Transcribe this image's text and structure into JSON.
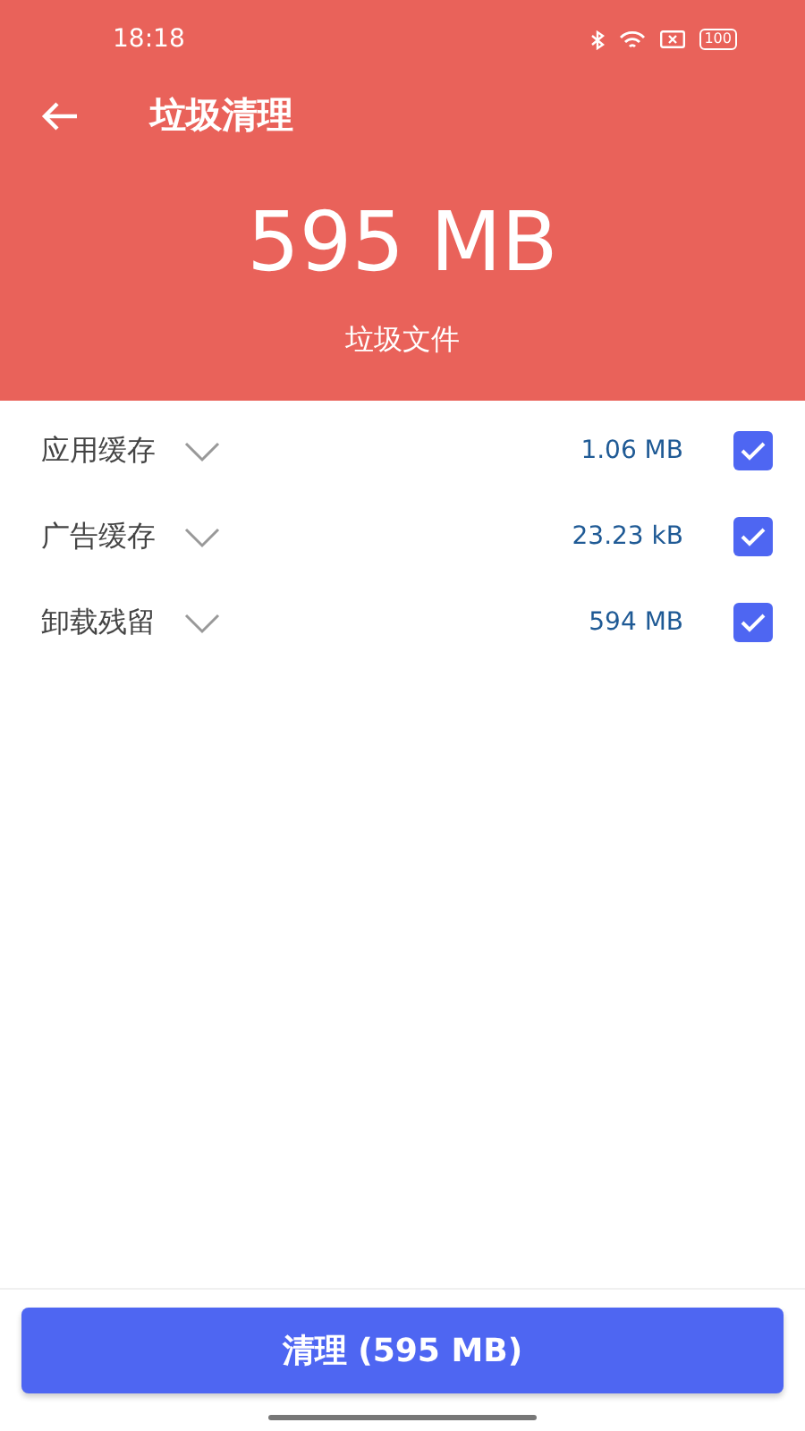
{
  "status_bar": {
    "time": "18:18",
    "battery": "100"
  },
  "app_bar": {
    "title": "垃圾清理"
  },
  "summary": {
    "total": "595 MB",
    "caption": "垃圾文件"
  },
  "categories": [
    {
      "name": "应用缓存",
      "size": "1.06 MB",
      "checked": true,
      "expanded": false
    },
    {
      "name": "广告缓存",
      "size": "23.23 kB",
      "checked": true,
      "expanded": false
    },
    {
      "name": "卸载残留",
      "size": "594 MB",
      "checked": true,
      "expanded": false
    }
  ],
  "clean_button": {
    "label": "清理 (595 MB)"
  }
}
